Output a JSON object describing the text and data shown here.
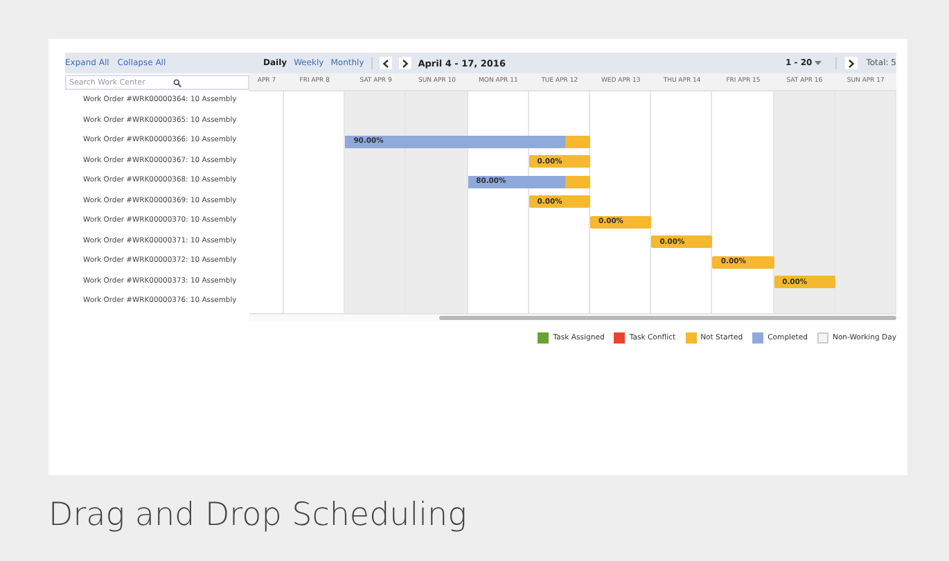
{
  "toolbar": {
    "links": [
      "Expand All",
      "Collapse All"
    ],
    "views": [
      {
        "label": "Daily",
        "selected": true
      },
      {
        "label": "Weekly",
        "selected": false
      },
      {
        "label": "Monthly",
        "selected": false
      }
    ],
    "date_range": "April 4 - 17, 2016",
    "page_range": "1 - 20",
    "total": "Total: 5"
  },
  "search": {
    "placeholder": "Search Work Center"
  },
  "columns": [
    {
      "label": "APR 7",
      "non_working": false
    },
    {
      "label": "FRI APR 8",
      "non_working": false
    },
    {
      "label": "SAT APR 9",
      "non_working": true
    },
    {
      "label": "SUN APR 10",
      "non_working": true
    },
    {
      "label": "MON APR 11",
      "non_working": false
    },
    {
      "label": "TUE APR 12",
      "non_working": false
    },
    {
      "label": "WED APR 13",
      "non_working": false
    },
    {
      "label": "THU APR 14",
      "non_working": false
    },
    {
      "label": "FRI APR 15",
      "non_working": false
    },
    {
      "label": "SAT APR 16",
      "non_working": true
    },
    {
      "label": "SUN APR 17",
      "non_working": true
    }
  ],
  "rows": [
    {
      "name": "Work Order #WRK00000364: 10 Assembly"
    },
    {
      "name": "Work Order #WRK00000365: 10 Assembly"
    },
    {
      "name": "Work Order #WRK00000366: 10 Assembly",
      "task": {
        "label": "90.00%",
        "level": 0.9
      }
    },
    {
      "name": "Work Order #WRK00000367: 10 Assembly",
      "task": {
        "label": "0.00%",
        "level": 0
      }
    },
    {
      "name": "Work Order #WRK00000368: 10 Assembly",
      "task": {
        "label": "80.00%",
        "level": 0.8
      }
    },
    {
      "name": "Work Order #WRK00000369: 10 Assembly",
      "task": {
        "label": "0.00%",
        "level": 0
      }
    },
    {
      "name": "Work Order #WRK00000370: 10 Assembly",
      "task": {
        "label": "0.00%",
        "level": 0
      }
    },
    {
      "name": "Work Order #WRK00000371: 10 Assembly",
      "task": {
        "label": "0.00%",
        "level": 0
      }
    },
    {
      "name": "Work Order #WRK00000372: 10 Assembly",
      "task": {
        "label": "0.00%",
        "level": 0
      }
    },
    {
      "name": "Work Order #WRK00000373: 10 Assembly",
      "task": {
        "label": "0.00%",
        "level": 0
      }
    },
    {
      "name": "Work Order #WRK00000376: 10 Assembly"
    }
  ],
  "legend": [
    {
      "label": "Task Assigned",
      "color": "#6aa232"
    },
    {
      "label": "Task Conflict",
      "color": "#e8452c"
    },
    {
      "label": "Not Started",
      "color": "#f5b82e"
    },
    {
      "label": "Completed",
      "color": "#8fa9dc"
    },
    {
      "label": "Non-Working Day",
      "color": "#f4f4f4"
    }
  ],
  "caption": "Drag and Drop Scheduling"
}
